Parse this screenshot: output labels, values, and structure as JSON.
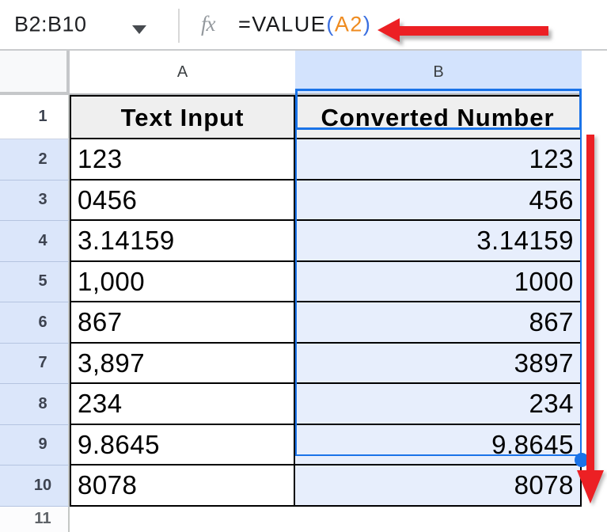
{
  "toolbar": {
    "name_box": "B2:B10",
    "fx_label": "fx",
    "formula": {
      "function": "=VALUE",
      "open_paren": "(",
      "reference": "A2",
      "close_paren": ")"
    }
  },
  "sheet": {
    "columns": [
      {
        "letter": "A"
      },
      {
        "letter": "B"
      }
    ],
    "header_row": {
      "number": "1",
      "text_input": "Text Input",
      "converted_number": "Converted Number"
    },
    "rows": [
      {
        "n": "2",
        "text": "123",
        "value": "123"
      },
      {
        "n": "3",
        "text": "0456",
        "value": "456"
      },
      {
        "n": "4",
        "text": "3.14159",
        "value": "3.14159"
      },
      {
        "n": "5",
        "text": "1,000",
        "value": "1000"
      },
      {
        "n": "6",
        "text": "867",
        "value": "867"
      },
      {
        "n": "7",
        "text": "3,897",
        "value": "3897"
      },
      {
        "n": "8",
        "text": "234",
        "value": "234"
      },
      {
        "n": "9",
        "text": "9.8645",
        "value": "9.8645"
      },
      {
        "n": "10",
        "text": "8078",
        "value": "8078"
      }
    ],
    "next_row": {
      "number": "11"
    },
    "selected_range": "B2:B10",
    "active_cell": "B2"
  },
  "colors": {
    "accent_blue": "#1a73e8",
    "selection_fill": "#e7eefc",
    "selected_column_header_fill": "#d3e3fd",
    "selected_row_header_fill": "#dbe6fa",
    "table_header_fill": "#efefef",
    "arrow_red": "#ec2024",
    "formula_reference_orange": "#ef8b1f",
    "formula_paren_blue": "#3a6fe0"
  }
}
